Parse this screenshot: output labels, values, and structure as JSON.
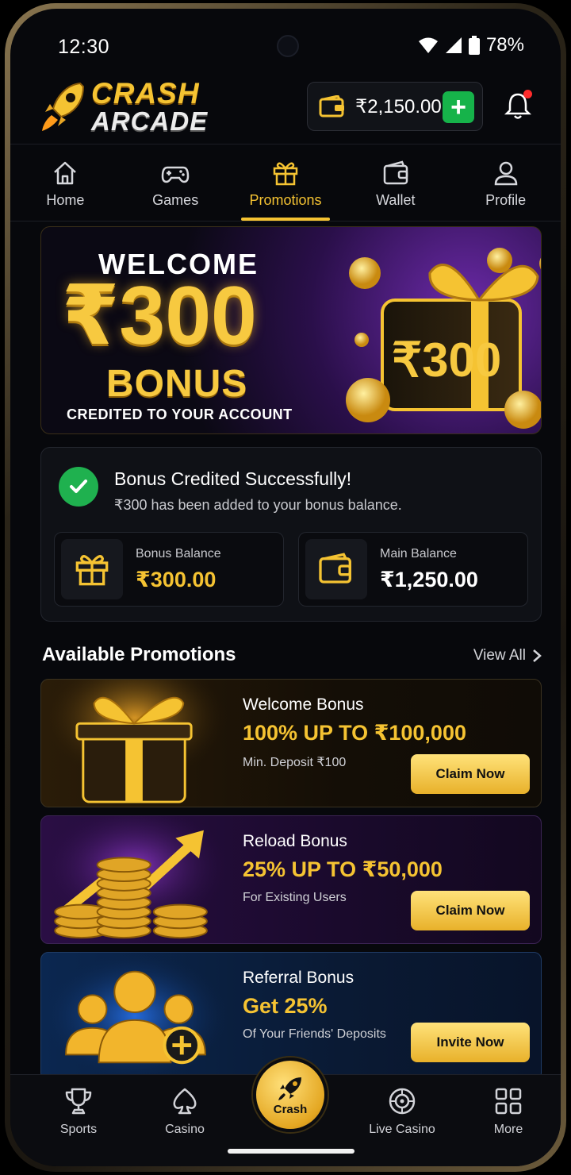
{
  "status_bar": {
    "time": "12:30",
    "battery": "78%"
  },
  "app": {
    "logo_line1": "CRASH",
    "logo_line2": "ARCADE"
  },
  "header": {
    "wallet_balance": "₹2,150.00"
  },
  "tabs": [
    {
      "label": "Home",
      "icon": "home-icon",
      "active": false
    },
    {
      "label": "Games",
      "icon": "gamepad-icon",
      "active": false
    },
    {
      "label": "Promotions",
      "icon": "gift-icon",
      "active": true
    },
    {
      "label": "Wallet",
      "icon": "wallet-icon",
      "active": false
    },
    {
      "label": "Profile",
      "icon": "user-icon",
      "active": false
    }
  ],
  "hero": {
    "welcome": "WELCOME",
    "amount": "₹300",
    "bonus": "BONUS",
    "subtitle": "CREDITED TO YOUR ACCOUNT",
    "gift_amount": "₹300"
  },
  "success": {
    "title": "Bonus Credited Successfully!",
    "message": "₹300 has been added to your bonus balance.",
    "bonus_balance_label": "Bonus Balance",
    "bonus_balance_value": "₹300.00",
    "main_balance_label": "Main Balance",
    "main_balance_value": "₹1,250.00"
  },
  "promotions": {
    "heading": "Available Promotions",
    "view_all": "View All",
    "items": [
      {
        "title": "Welcome Bonus",
        "value": "100% UP TO ₹100,000",
        "subtitle": "Min. Deposit ₹100",
        "button": "Claim Now"
      },
      {
        "title": "Reload Bonus",
        "value": "25% UP TO ₹50,000",
        "subtitle": "For Existing Users",
        "button": "Claim Now"
      },
      {
        "title": "Referral Bonus",
        "value": "Get 25%",
        "subtitle": "Of Your Friends' Deposits",
        "button": "Invite Now"
      }
    ]
  },
  "bottom_nav": [
    {
      "label": "Sports",
      "icon": "trophy-icon"
    },
    {
      "label": "Casino",
      "icon": "spade-icon"
    },
    {
      "label": "Crash",
      "icon": "rocket-icon"
    },
    {
      "label": "Live Casino",
      "icon": "roulette-icon"
    },
    {
      "label": "More",
      "icon": "grid-icon"
    }
  ],
  "colors": {
    "accent": "#f5c332",
    "success": "#1fb14f",
    "background": "#07080c"
  }
}
